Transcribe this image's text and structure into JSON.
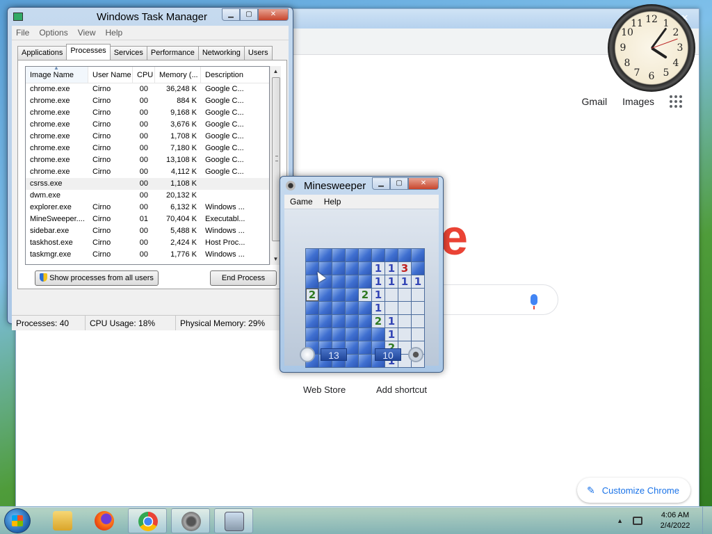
{
  "chrome": {
    "links": {
      "gmail": "Gmail",
      "images": "Images"
    },
    "logo_fragment": "e",
    "shortcuts": [
      "Web Store",
      "Add shortcut"
    ],
    "customize_label": "Customize Chrome"
  },
  "taskmgr": {
    "title": "Windows Task Manager",
    "menu": [
      "File",
      "Options",
      "View",
      "Help"
    ],
    "tabs": [
      "Applications",
      "Processes",
      "Services",
      "Performance",
      "Networking",
      "Users"
    ],
    "active_tab": "Processes",
    "columns": [
      "Image Name",
      "User Name",
      "CPU",
      "Memory (...",
      "Description"
    ],
    "rows": [
      [
        "chrome.exe",
        "Cirno",
        "00",
        "36,248 K",
        "Google C..."
      ],
      [
        "chrome.exe",
        "Cirno",
        "00",
        "884 K",
        "Google C..."
      ],
      [
        "chrome.exe",
        "Cirno",
        "00",
        "9,168 K",
        "Google C..."
      ],
      [
        "chrome.exe",
        "Cirno",
        "00",
        "3,676 K",
        "Google C..."
      ],
      [
        "chrome.exe",
        "Cirno",
        "00",
        "1,708 K",
        "Google C..."
      ],
      [
        "chrome.exe",
        "Cirno",
        "00",
        "7,180 K",
        "Google C..."
      ],
      [
        "chrome.exe",
        "Cirno",
        "00",
        "13,108 K",
        "Google C..."
      ],
      [
        "chrome.exe",
        "Cirno",
        "00",
        "4,112 K",
        "Google C..."
      ],
      [
        "csrss.exe",
        "",
        "00",
        "1,108 K",
        ""
      ],
      [
        "dwm.exe",
        "",
        "00",
        "20,132 K",
        ""
      ],
      [
        "explorer.exe",
        "Cirno",
        "00",
        "6,132 K",
        "Windows ..."
      ],
      [
        "MineSweeper....",
        "Cirno",
        "01",
        "70,404 K",
        "Executabl..."
      ],
      [
        "sidebar.exe",
        "Cirno",
        "00",
        "5,488 K",
        "Windows ..."
      ],
      [
        "taskhost.exe",
        "Cirno",
        "00",
        "2,424 K",
        "Host Proc..."
      ],
      [
        "taskmgr.exe",
        "Cirno",
        "00",
        "1,776 K",
        "Windows ..."
      ]
    ],
    "selected_row": 8,
    "show_all_button": "Show processes from all users",
    "end_process_button": "End Process",
    "status": {
      "processes": "Processes: 40",
      "cpu": "CPU Usage: 18%",
      "memory": "Physical Memory: 29%"
    }
  },
  "minesweeper": {
    "title": "Minesweeper",
    "menu": [
      "Game",
      "Help"
    ],
    "board": [
      "UUUUUUUUU",
      "UUUUU113U",
      "UUUUU1O111",
      "2UUU21OOO",
      "UUUUU1OOO",
      "UUUUU21OO",
      "UUUUUU1OO",
      "UUUUUU2OO",
      "UUUUUU1OO"
    ],
    "timer": "13",
    "mines_left": "10"
  },
  "taskbar": {
    "time": "4:06 AM",
    "date": "2/4/2022"
  }
}
